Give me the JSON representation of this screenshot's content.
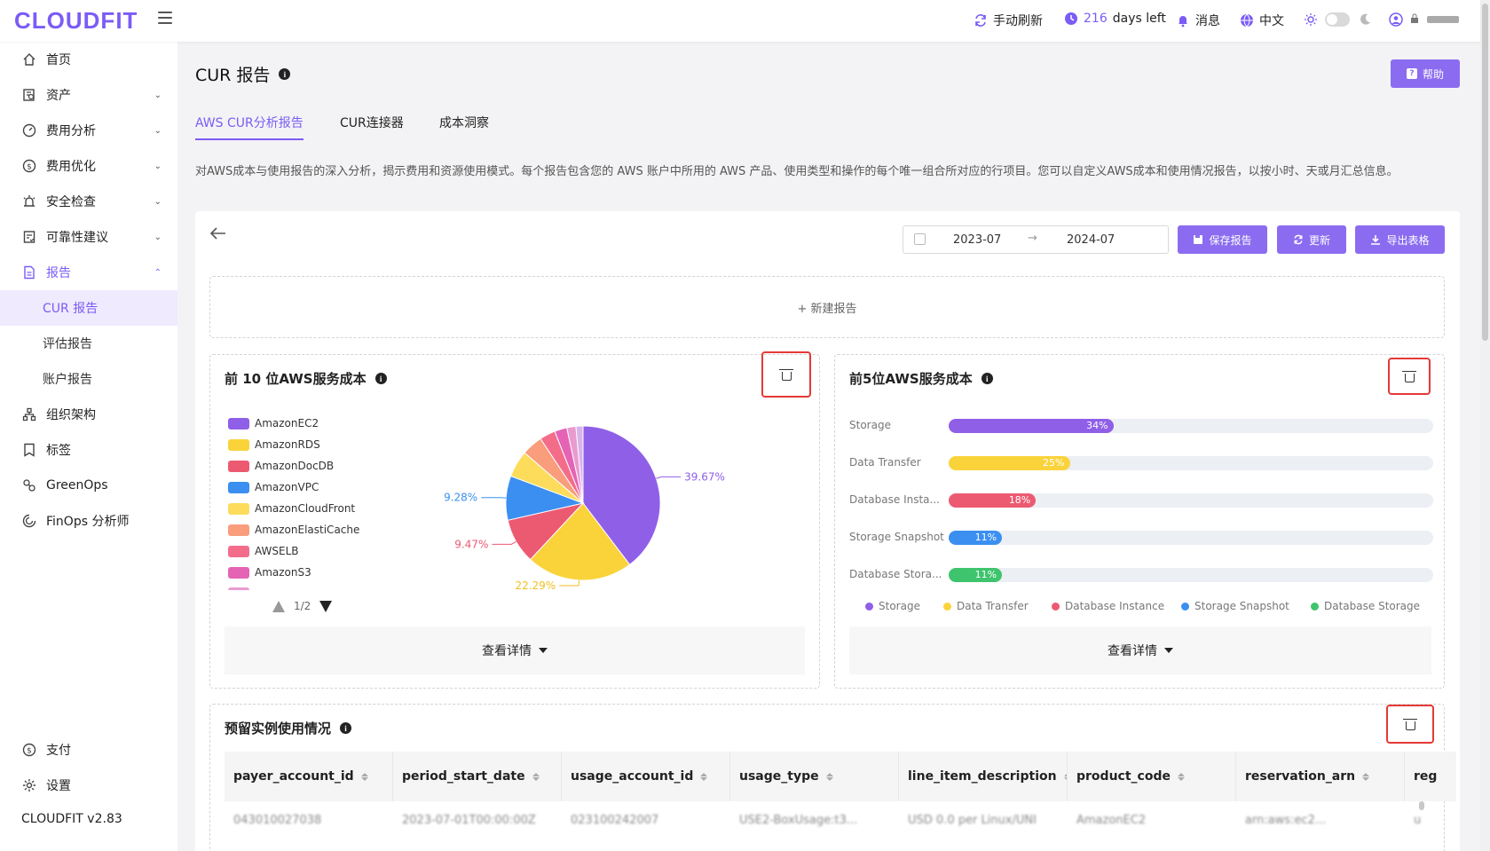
{
  "app": {
    "logo": "CLOUDFIT",
    "version": "CLOUDFIT v2.83"
  },
  "header": {
    "refresh_label": "手动刷新",
    "days_value": "216",
    "days_suffix": "days left",
    "messages_label": "消息",
    "language_label": "中文"
  },
  "sidebar": {
    "items": [
      {
        "label": "首页",
        "icon": "home-icon"
      },
      {
        "label": "资产",
        "icon": "asset-icon"
      },
      {
        "label": "费用分析",
        "icon": "dashboard-icon"
      },
      {
        "label": "费用优化",
        "icon": "dollar-icon"
      },
      {
        "label": "安全检查",
        "icon": "alarm-icon"
      },
      {
        "label": "可靠性建议",
        "icon": "checklist-icon"
      },
      {
        "label": "报告",
        "icon": "file-icon"
      },
      {
        "label": "组织架构",
        "icon": "org-icon"
      },
      {
        "label": "标签",
        "icon": "tag-icon"
      },
      {
        "label": "GreenOps",
        "icon": "leaf-icon"
      },
      {
        "label": "FinOps 分析师",
        "icon": "finops-icon"
      }
    ],
    "report_sub": [
      "CUR 报告",
      "评估报告",
      "账户报告"
    ],
    "bottom": [
      {
        "label": "支付",
        "icon": "payment-icon"
      },
      {
        "label": "设置",
        "icon": "settings-icon"
      }
    ]
  },
  "page": {
    "title": "CUR 报告",
    "help_label": "帮助",
    "tabs": [
      "AWS CUR分析报告",
      "CUR连接器",
      "成本洞察"
    ],
    "description": "对AWS成本与使用报告的深入分析，揭示费用和资源使用模式。每个报告包含您的 AWS 账户中所用的 AWS 产品、使用类型和操作的每个唯一组合所对应的行项目。您可以自定义AWS成本和使用情况报告，以按小时、天或月汇总信息。"
  },
  "toolbar": {
    "date_from": "2023-07",
    "date_to": "2024-07",
    "save_label": "保存报告",
    "update_label": "更新",
    "export_label": "导出表格",
    "new_report_label": "+ 新建报告"
  },
  "top10": {
    "title": "前 10 位AWS服务成本",
    "pager": "1/2",
    "details_label": "查看详情",
    "legend": [
      {
        "name": "AmazonEC2",
        "color": "#8f5fe8"
      },
      {
        "name": "AmazonRDS",
        "color": "#fad33b"
      },
      {
        "name": "AmazonDocDB",
        "color": "#ec5a72"
      },
      {
        "name": "AmazonVPC",
        "color": "#3b8ff0"
      },
      {
        "name": "AmazonCloudFront",
        "color": "#fddc5c"
      },
      {
        "name": "AmazonElastiCache",
        "color": "#f99d7c"
      },
      {
        "name": "AWSELB",
        "color": "#f36d8a"
      },
      {
        "name": "AmazonS3",
        "color": "#e463b4"
      }
    ]
  },
  "chart_data": [
    {
      "type": "pie",
      "title": "前 10 位AWS服务成本",
      "values": [
        39.67,
        22.29,
        9.47,
        9.28,
        5.6,
        4.4,
        3.3,
        2.6,
        1.9,
        1.48
      ],
      "colors": [
        "#8f5fe8",
        "#fad33b",
        "#ec5a72",
        "#3b8ff0",
        "#fddc5c",
        "#f99d7c",
        "#f36d8a",
        "#e463b4",
        "#e99bd0",
        "#d9b3ea"
      ],
      "labels_shown": [
        "39.67%",
        "22.29%",
        "9.47%",
        "9.28%"
      ],
      "label_colors": [
        "#8f5fe8",
        "#f0c020",
        "#ec5a72",
        "#3b8ff0"
      ]
    },
    {
      "type": "bar",
      "title": "前5位AWS服务成本",
      "categories": [
        "Storage",
        "Data Transfer",
        "Database Instance",
        "Storage Snapshot",
        "Database Storage"
      ],
      "category_labels": [
        "Storage",
        "Data Transfer",
        "Database Insta...",
        "Storage Snapshot",
        "Database Stora..."
      ],
      "values": [
        34,
        25,
        18,
        11,
        11
      ],
      "value_labels": [
        "34%",
        "25%",
        "18%",
        "11%",
        "11%"
      ],
      "colors": [
        "#8f5fe8",
        "#fad33b",
        "#ec5a72",
        "#3b8ff0",
        "#3ec46d"
      ],
      "legend_placement": "bottom"
    }
  ],
  "top5": {
    "title": "前5位AWS服务成本",
    "details_label": "查看详情"
  },
  "reserved": {
    "title": "预留实例使用情况",
    "columns": [
      "payer_account_id",
      "period_start_date",
      "usage_account_id",
      "usage_type",
      "line_item_description",
      "product_code",
      "reservation_arn",
      "reg"
    ],
    "first_row": [
      "043010027038",
      "2023-07-01T00:00:00Z",
      "023100242007",
      "USE2-BoxUsage:t3...",
      "USD 0.0 per Linux/UNI",
      "AmazonEC2",
      "arn:aws:ec2...",
      "u"
    ]
  }
}
